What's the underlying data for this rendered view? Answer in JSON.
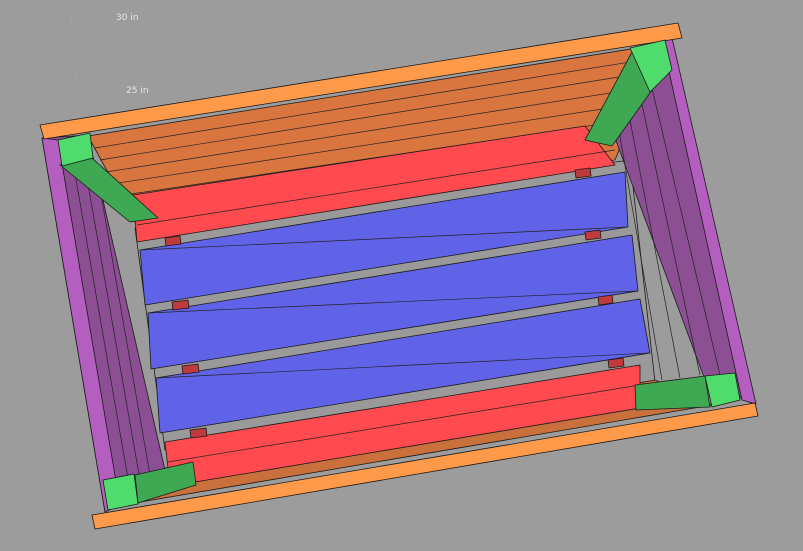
{
  "viewport": {
    "dimension_labels": [
      "30 in",
      "25 in"
    ]
  },
  "colors": {
    "background": "#9c9c9c",
    "frame_orange": "#ff9a4a",
    "slat_orange": "#d9763f",
    "side_purple": "#b45fc0",
    "side_purple_dark": "#8c4f94",
    "board_red": "#ff4a4f",
    "board_blue": "#6063e8",
    "post_green": "#3fa852",
    "post_green_light": "#4fdc6c",
    "gap_gray": "#9a9a9a"
  }
}
